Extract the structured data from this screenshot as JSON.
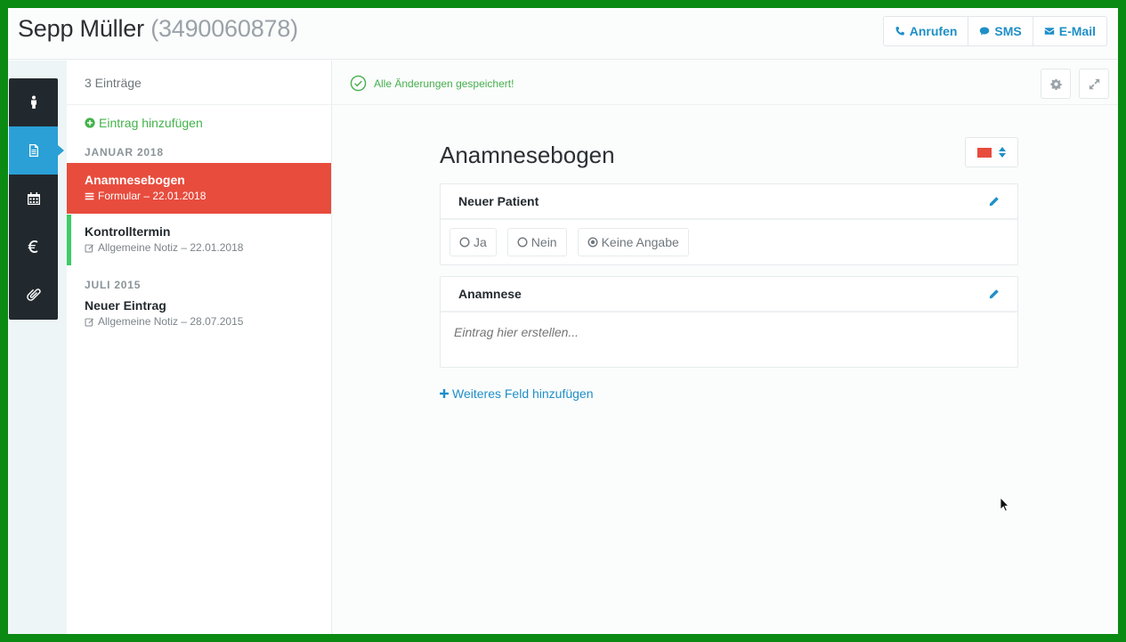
{
  "header": {
    "patient_name": "Sepp Müller",
    "patient_phone": "(3490060878)",
    "actions": {
      "call": "Anrufen",
      "sms": "SMS",
      "email": "E-Mail"
    }
  },
  "rail": {
    "items": [
      {
        "icon": "person-icon",
        "active": false
      },
      {
        "icon": "document-icon",
        "active": true
      },
      {
        "icon": "calendar-icon",
        "active": false
      },
      {
        "icon": "euro-icon",
        "active": false
      },
      {
        "icon": "paperclip-icon",
        "active": false
      }
    ]
  },
  "entries": {
    "count_label": "3 Einträge",
    "add_label": "Eintrag hinzufügen",
    "groups": [
      {
        "month": "JANUAR 2018",
        "items": [
          {
            "title": "Anamnesebogen",
            "subtitle": "Formular – 22.01.2018",
            "selected": true
          },
          {
            "title": "Kontrolltermin",
            "subtitle": "Allgemeine Notiz – 22.01.2018",
            "selected": false
          }
        ]
      },
      {
        "month": "JULI 2015",
        "items": [
          {
            "title": "Neuer Eintrag",
            "subtitle": "Allgemeine Notiz – 28.07.2015",
            "selected": false
          }
        ]
      }
    ]
  },
  "main": {
    "status": "Alle Änderungen gespeichert!",
    "form_title": "Anamnesebogen",
    "color": "#e84c3d",
    "fields": [
      {
        "label": "Neuer Patient",
        "options": [
          "Ja",
          "Nein",
          "Keine Angabe"
        ],
        "selected": "Keine Angabe"
      },
      {
        "label": "Anamnese",
        "placeholder": "Eintrag hier erstellen..."
      }
    ],
    "add_field_label": "Weiteres Feld hinzufügen"
  },
  "colors": {
    "accent_blue": "#1f8fc7",
    "success_green": "#46b04e",
    "selected_red": "#e84c3d",
    "rail_dark": "#22292e"
  }
}
